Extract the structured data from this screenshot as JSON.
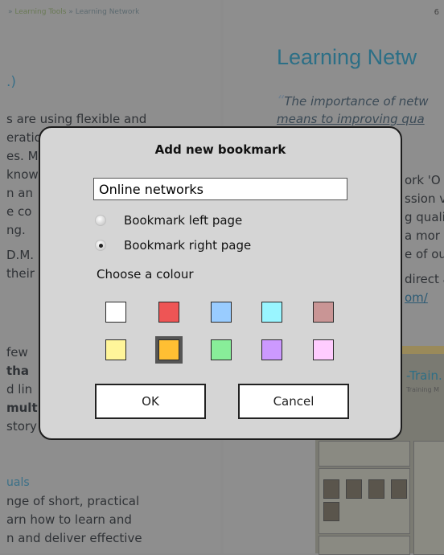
{
  "background": {
    "breadcrumb_section": "Learning Tools",
    "breadcrumb_page": "Learning Network",
    "breadcrumb_sep": "»",
    "page_number": "6",
    "title": "Learning Netw",
    "left_heading": ".)",
    "quote_line1": "The importance of netw",
    "quote_line2": "means to improving qua",
    "left_lines": [
      "s are using flexible and",
      "eratio",
      "es. M",
      "know",
      "n an",
      "e co",
      "ng.",
      "D.M.",
      "their"
    ],
    "right_lines": [
      "ork 'O",
      "ssion v",
      "g quali",
      "a mor",
      "e of ou",
      "direct a"
    ],
    "right_link": "om/",
    "left_lines2": [
      "few",
      "tha",
      "d lin",
      "mult",
      "story"
    ],
    "ad_brand": "-Train.",
    "ad_sub": "Training M",
    "section_heading": "uals",
    "bottom_lines": [
      "nge of short, practical",
      "arn how to learn and",
      "n and deliver effective"
    ]
  },
  "dialog": {
    "title": "Add new bookmark",
    "name_value": "Online networks",
    "options": [
      {
        "label": "Bookmark left page",
        "checked": false
      },
      {
        "label": "Bookmark right page",
        "checked": true
      }
    ],
    "colour_label": "Choose a colour",
    "colours": [
      "#ffffff",
      "#ee5555",
      "#99ccff",
      "#99f5ff",
      "#c99595",
      "#fff59a",
      "#ffbf33",
      "#88ee99",
      "#cc99ff",
      "#ffccff"
    ],
    "selected_colour": "#ffbf33",
    "ok_label": "OK",
    "cancel_label": "Cancel"
  }
}
